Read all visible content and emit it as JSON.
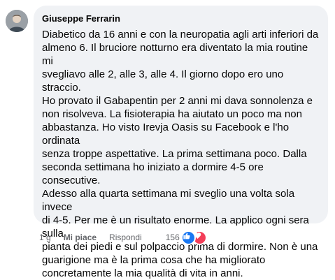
{
  "comment": {
    "author": "Giuseppe Ferrarin",
    "avatar_icon": "user-avatar",
    "text": "Diabetico da 16 anni e con la neuropatia agli arti inferiori da\nalmeno 6. Il bruciore notturno era diventato la mia routine mi\nsvegliavo alle 2, alle 3, alle 4. Il giorno dopo ero uno straccio.\nHo provato il Gabapentin per 2 anni mi dava sonnolenza e\nnon risolveva. La fisioterapia ha aiutato un poco ma non\nabbastanza. Ho visto Irevja Oasis su Facebook e l'ho ordinata\nsenza troppe aspettative. La prima settimana poco. Dalla\nseconda settimana ho iniziato a dormire 4-5 ore consecutive.\nAdesso alla quarta settimana mi sveglio una volta sola invece\ndi 4-5. Per me è un risultato enorme. La applico ogni sera sulla\npianta dei piedi e sul polpaccio prima di dormire. Non è una\nguarigione ma è la prima cosa che ha migliorato\nconcretamente la mia qualità di vita in anni.",
    "time": "1 g",
    "like_label": "Mi piace",
    "reply_label": "Rispondi",
    "reaction_count": "156",
    "reactions": [
      "like-icon",
      "love-icon"
    ]
  },
  "colors": {
    "bubble_bg": "#f0f2f5",
    "meta_text": "#65676b",
    "like_blue": "#1877f2",
    "love_red": "#f33e58"
  }
}
